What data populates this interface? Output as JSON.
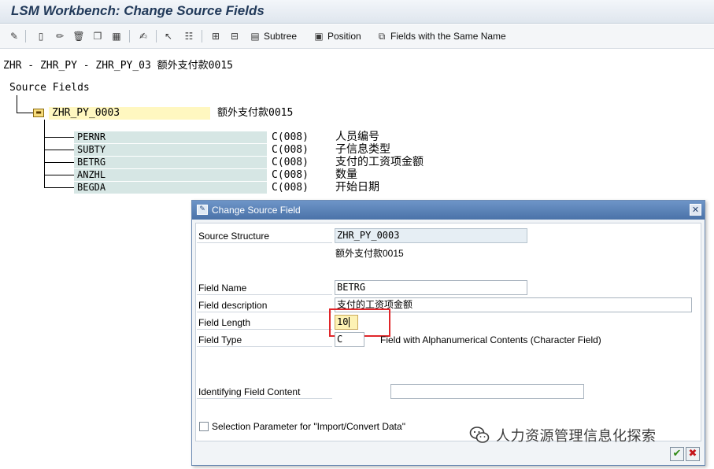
{
  "window": {
    "title": "LSM Workbench: Change Source Fields"
  },
  "toolbar": {
    "subtree_label": "Subtree",
    "position_label": "Position",
    "same_name_label": "Fields with the Same Name"
  },
  "path_line": "ZHR - ZHR_PY - ZHR_PY_03 额外支付款0015",
  "tree": {
    "root_label": "Source Fields",
    "structure": {
      "name": "ZHR_PY_0003",
      "description": "额外支付款0015"
    },
    "fields": [
      {
        "name": "PERNR",
        "type": "C(008)",
        "description": "人员编号"
      },
      {
        "name": "SUBTY",
        "type": "C(008)",
        "description": "子信息类型"
      },
      {
        "name": "BETRG",
        "type": "C(008)",
        "description": "支付的工资项金额"
      },
      {
        "name": "ANZHL",
        "type": "C(008)",
        "description": "数量"
      },
      {
        "name": "BEGDA",
        "type": "C(008)",
        "description": "开始日期"
      }
    ]
  },
  "dialog": {
    "title": "Change Source Field",
    "source_structure_label": "Source Structure",
    "source_structure_value": "ZHR_PY_0003",
    "source_structure_desc": "额外支付款0015",
    "field_name_label": "Field Name",
    "field_name_value": "BETRG",
    "field_description_label": "Field description",
    "field_description_value": "支付的工资项金额",
    "field_length_label": "Field Length",
    "field_length_value": "10",
    "field_type_label": "Field Type",
    "field_type_value": "C",
    "field_type_desc": "Field with Alphanumerical Contents (Character Field)",
    "identifying_label": "Identifying Field Content",
    "identifying_value": "",
    "selection_param_label": "Selection Parameter for \"Import/Convert Data\"",
    "selection_param_checked": false
  },
  "watermark": {
    "text": "人力资源管理信息化探索"
  },
  "colors": {
    "highlight": "#e0262a",
    "dialog_title": "#4a72a8",
    "field_bg": "#d6e6e4",
    "struct_bg": "#fff7c0"
  }
}
